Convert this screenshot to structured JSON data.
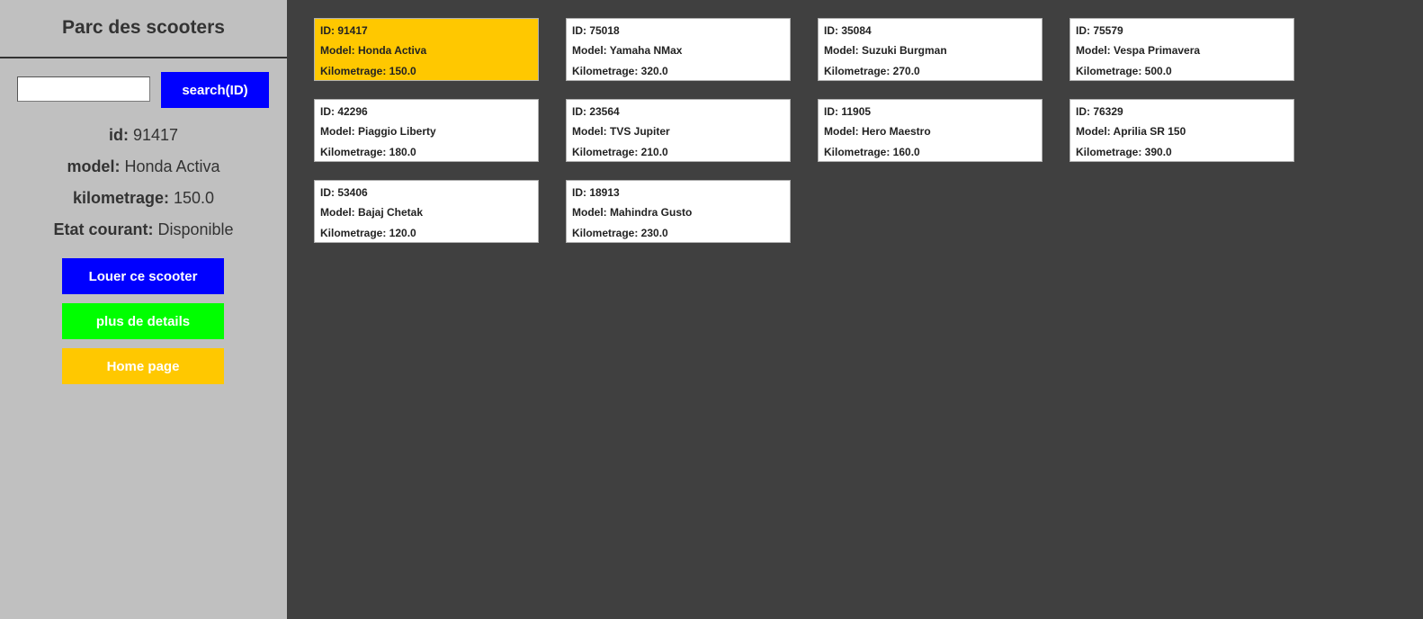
{
  "sidebar": {
    "title": "Parc des scooters",
    "search": {
      "value": "",
      "button_label": "search(ID)"
    },
    "details": {
      "id_label": "id:",
      "id_value": "91417",
      "model_label": "model:",
      "model_value": "Honda Activa",
      "km_label": "kilometrage:",
      "km_value": "150.0",
      "etat_label": "Etat courant:",
      "etat_value": "Disponible"
    },
    "buttons": {
      "rent_label": "Louer ce scooter",
      "details_label": "plus de details",
      "home_label": "Home page"
    }
  },
  "colors": {
    "sidebar_bg": "#c0c0c0",
    "main_bg": "#404040",
    "search_button": "#0000ff",
    "rent_button": "#0000ff",
    "details_button": "#00ff00",
    "home_button": "#ffc800",
    "selected_card": "#ffc800",
    "card_bg": "#ffffff"
  },
  "selected_card_index": 0,
  "scooters": [
    {
      "id": "ID: 91417",
      "model": "Model: Honda Activa",
      "km": "Kilometrage: 150.0"
    },
    {
      "id": "ID: 75018",
      "model": "Model: Yamaha NMax",
      "km": "Kilometrage: 320.0"
    },
    {
      "id": "ID: 35084",
      "model": "Model: Suzuki Burgman",
      "km": "Kilometrage: 270.0"
    },
    {
      "id": "ID: 75579",
      "model": "Model: Vespa Primavera",
      "km": "Kilometrage: 500.0"
    },
    {
      "id": "ID: 42296",
      "model": "Model: Piaggio Liberty",
      "km": "Kilometrage: 180.0"
    },
    {
      "id": "ID: 23564",
      "model": "Model: TVS Jupiter",
      "km": "Kilometrage: 210.0"
    },
    {
      "id": "ID: 11905",
      "model": "Model: Hero Maestro",
      "km": "Kilometrage: 160.0"
    },
    {
      "id": "ID: 76329",
      "model": "Model: Aprilia SR 150",
      "km": "Kilometrage: 390.0"
    },
    {
      "id": "ID: 53406",
      "model": "Model: Bajaj Chetak",
      "km": "Kilometrage: 120.0"
    },
    {
      "id": "ID: 18913",
      "model": "Model: Mahindra Gusto",
      "km": "Kilometrage: 230.0"
    }
  ]
}
